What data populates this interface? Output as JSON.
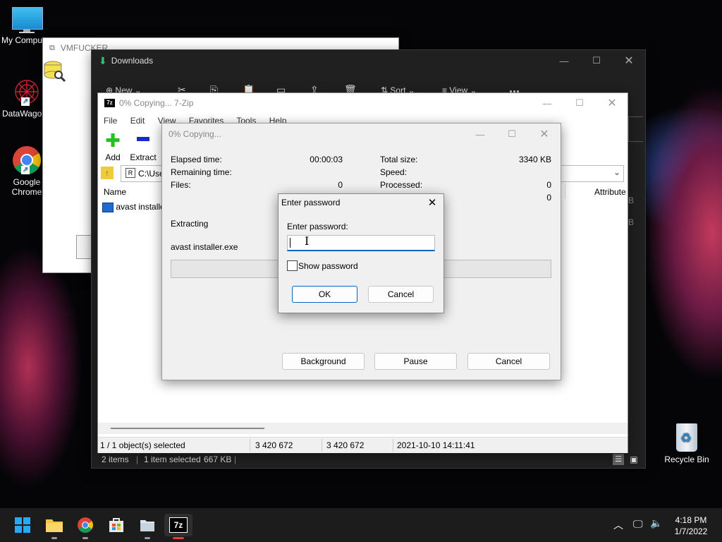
{
  "desktop": {
    "icons": [
      {
        "label": "My Compu"
      },
      {
        "label": "DataWagon"
      },
      {
        "label": "Google Chrome"
      },
      {
        "label": "Recycle Bin"
      }
    ]
  },
  "vmf_window": {
    "title": "VMFUCKER"
  },
  "explorer": {
    "title": "Downloads",
    "toolbar": {
      "new": "New",
      "sort": "Sort",
      "view": "View",
      "more": "..."
    },
    "status": {
      "items": "2 items",
      "selected": "1 item selected",
      "size": "667 KB"
    }
  },
  "sevenzip": {
    "title": "0% Copying... 7-Zip",
    "menu": [
      "File",
      "Edit",
      "View",
      "Favorites",
      "Tools",
      "Help"
    ],
    "toolbar": {
      "add": "Add",
      "extract": "Extract"
    },
    "address": "C:\\Use",
    "columns": {
      "name": "Name",
      "attributes": "Attribute"
    },
    "file": "avast installe",
    "right_col_values": [
      "B",
      "B"
    ],
    "status": {
      "selected": "1 / 1 object(s) selected",
      "size1": "3 420 672",
      "size2": "3 420 672",
      "date": "2021-10-10 14:11:41"
    }
  },
  "copying": {
    "title": "0% Copying...",
    "elapsed_label": "Elapsed time:",
    "elapsed_value": "00:00:03",
    "remaining_label": "Remaining time:",
    "files_label": "Files:",
    "files_value": "0",
    "total_label": "Total size:",
    "total_value": "3340 KB",
    "speed_label": "Speed:",
    "processed_label": "Processed:",
    "processed_value": "0",
    "extra_value": "0",
    "extracting_label": "Extracting",
    "filename": "avast installer.exe",
    "progress": 0,
    "buttons": {
      "background": "Background",
      "pause": "Pause",
      "cancel": "Cancel"
    }
  },
  "password_dialog": {
    "title": "Enter password",
    "prompt": "Enter password:",
    "value": "",
    "show_password_label": "Show password",
    "show_password_checked": false,
    "ok": "OK",
    "cancel": "Cancel"
  },
  "taskbar": {
    "time": "4:18 PM",
    "date": "1/7/2022",
    "apps": [
      "start-icon",
      "file-explorer-icon",
      "chrome-icon",
      "store-icon",
      "folder-icon",
      "7zip-icon"
    ],
    "colors": {
      "bar": "#1c1c1c",
      "accent": "#0067c0",
      "active_underline": "#e0403a"
    }
  }
}
